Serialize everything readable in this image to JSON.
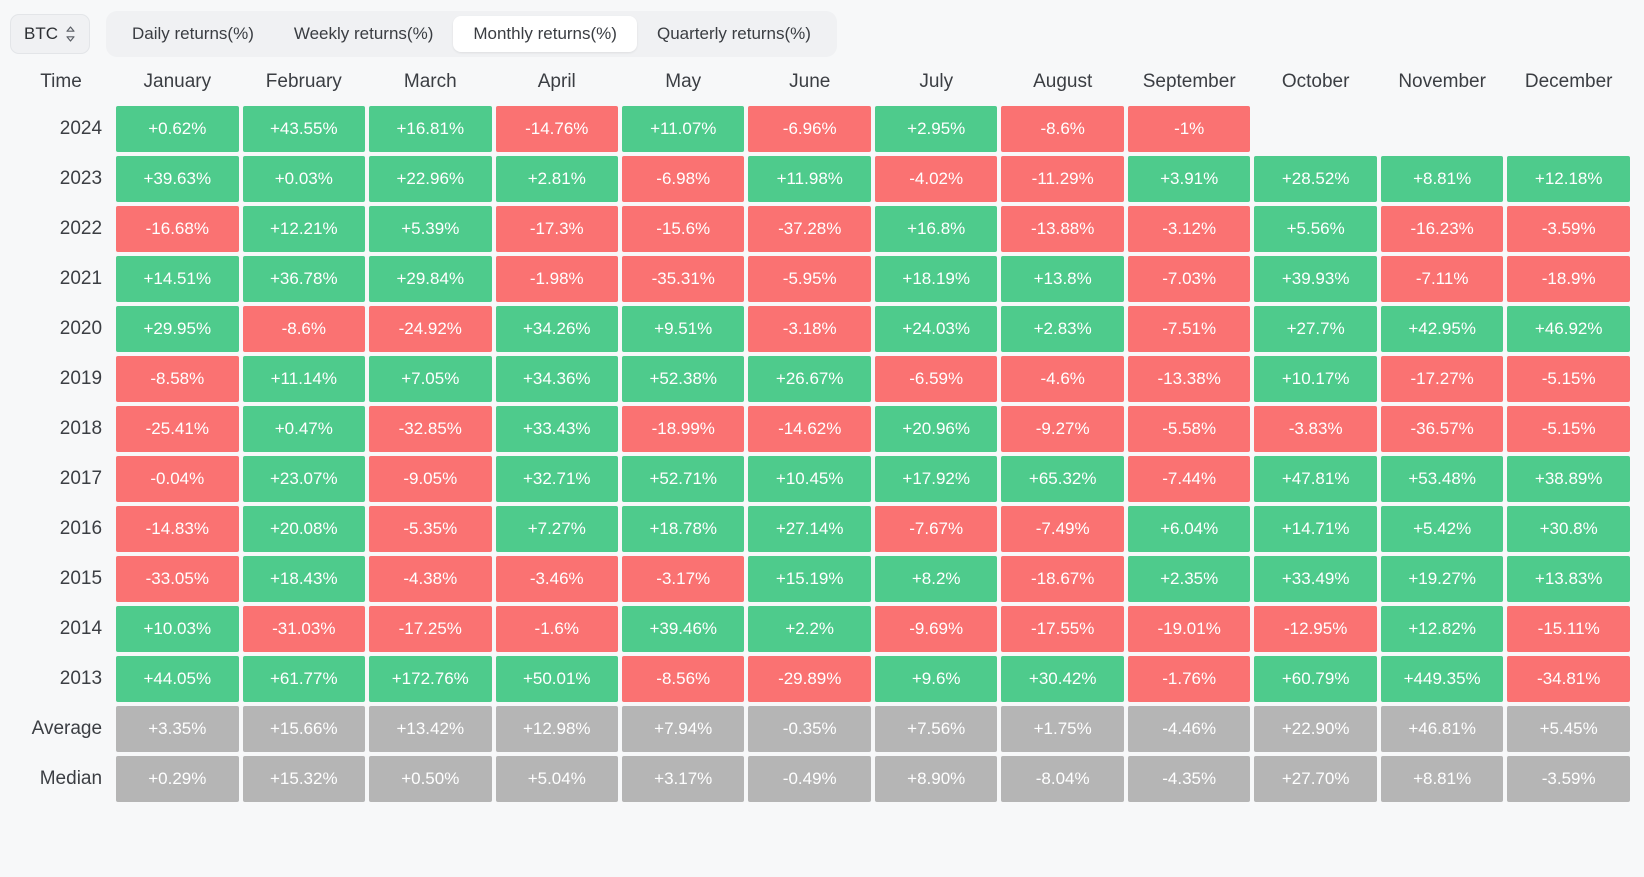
{
  "toolbar": {
    "symbol": "BTC",
    "symbol_icon": "chevron-up-down-icon",
    "tabs": [
      {
        "label": "Daily returns(%)",
        "active": false
      },
      {
        "label": "Weekly returns(%)",
        "active": false
      },
      {
        "label": "Monthly returns(%)",
        "active": true
      },
      {
        "label": "Quarterly returns(%)",
        "active": false
      }
    ]
  },
  "colors": {
    "positive": "#4ECB8C",
    "negative": "#FA7272",
    "neutral": "#b5b5b5",
    "background": "#f7f8f9",
    "tabbar": "#f0f1f3"
  },
  "table": {
    "columns": [
      "Time",
      "January",
      "February",
      "March",
      "April",
      "May",
      "June",
      "July",
      "August",
      "September",
      "October",
      "November",
      "December"
    ],
    "rows": [
      {
        "label": "2024",
        "kind": "year",
        "values": [
          "+0.62%",
          "+43.55%",
          "+16.81%",
          "-14.76%",
          "+11.07%",
          "-6.96%",
          "+2.95%",
          "-8.6%",
          "-1%",
          "",
          "",
          ""
        ]
      },
      {
        "label": "2023",
        "kind": "year",
        "values": [
          "+39.63%",
          "+0.03%",
          "+22.96%",
          "+2.81%",
          "-6.98%",
          "+11.98%",
          "-4.02%",
          "-11.29%",
          "+3.91%",
          "+28.52%",
          "+8.81%",
          "+12.18%"
        ]
      },
      {
        "label": "2022",
        "kind": "year",
        "values": [
          "-16.68%",
          "+12.21%",
          "+5.39%",
          "-17.3%",
          "-15.6%",
          "-37.28%",
          "+16.8%",
          "-13.88%",
          "-3.12%",
          "+5.56%",
          "-16.23%",
          "-3.59%"
        ]
      },
      {
        "label": "2021",
        "kind": "year",
        "values": [
          "+14.51%",
          "+36.78%",
          "+29.84%",
          "-1.98%",
          "-35.31%",
          "-5.95%",
          "+18.19%",
          "+13.8%",
          "-7.03%",
          "+39.93%",
          "-7.11%",
          "-18.9%"
        ]
      },
      {
        "label": "2020",
        "kind": "year",
        "values": [
          "+29.95%",
          "-8.6%",
          "-24.92%",
          "+34.26%",
          "+9.51%",
          "-3.18%",
          "+24.03%",
          "+2.83%",
          "-7.51%",
          "+27.7%",
          "+42.95%",
          "+46.92%"
        ]
      },
      {
        "label": "2019",
        "kind": "year",
        "values": [
          "-8.58%",
          "+11.14%",
          "+7.05%",
          "+34.36%",
          "+52.38%",
          "+26.67%",
          "-6.59%",
          "-4.6%",
          "-13.38%",
          "+10.17%",
          "-17.27%",
          "-5.15%"
        ]
      },
      {
        "label": "2018",
        "kind": "year",
        "values": [
          "-25.41%",
          "+0.47%",
          "-32.85%",
          "+33.43%",
          "-18.99%",
          "-14.62%",
          "+20.96%",
          "-9.27%",
          "-5.58%",
          "-3.83%",
          "-36.57%",
          "-5.15%"
        ]
      },
      {
        "label": "2017",
        "kind": "year",
        "values": [
          "-0.04%",
          "+23.07%",
          "-9.05%",
          "+32.71%",
          "+52.71%",
          "+10.45%",
          "+17.92%",
          "+65.32%",
          "-7.44%",
          "+47.81%",
          "+53.48%",
          "+38.89%"
        ]
      },
      {
        "label": "2016",
        "kind": "year",
        "values": [
          "-14.83%",
          "+20.08%",
          "-5.35%",
          "+7.27%",
          "+18.78%",
          "+27.14%",
          "-7.67%",
          "-7.49%",
          "+6.04%",
          "+14.71%",
          "+5.42%",
          "+30.8%"
        ]
      },
      {
        "label": "2015",
        "kind": "year",
        "values": [
          "-33.05%",
          "+18.43%",
          "-4.38%",
          "-3.46%",
          "-3.17%",
          "+15.19%",
          "+8.2%",
          "-18.67%",
          "+2.35%",
          "+33.49%",
          "+19.27%",
          "+13.83%"
        ]
      },
      {
        "label": "2014",
        "kind": "year",
        "values": [
          "+10.03%",
          "-31.03%",
          "-17.25%",
          "-1.6%",
          "+39.46%",
          "+2.2%",
          "-9.69%",
          "-17.55%",
          "-19.01%",
          "-12.95%",
          "+12.82%",
          "-15.11%"
        ]
      },
      {
        "label": "2013",
        "kind": "year",
        "values": [
          "+44.05%",
          "+61.77%",
          "+172.76%",
          "+50.01%",
          "-8.56%",
          "-29.89%",
          "+9.6%",
          "+30.42%",
          "-1.76%",
          "+60.79%",
          "+449.35%",
          "-34.81%"
        ]
      },
      {
        "label": "Average",
        "kind": "summary",
        "values": [
          "+3.35%",
          "+15.66%",
          "+13.42%",
          "+12.98%",
          "+7.94%",
          "-0.35%",
          "+7.56%",
          "+1.75%",
          "-4.46%",
          "+22.90%",
          "+46.81%",
          "+5.45%"
        ]
      },
      {
        "label": "Median",
        "kind": "summary",
        "values": [
          "+0.29%",
          "+15.32%",
          "+0.50%",
          "+5.04%",
          "+3.17%",
          "-0.49%",
          "+8.90%",
          "-8.04%",
          "-4.35%",
          "+27.70%",
          "+8.81%",
          "-3.59%"
        ]
      }
    ]
  }
}
